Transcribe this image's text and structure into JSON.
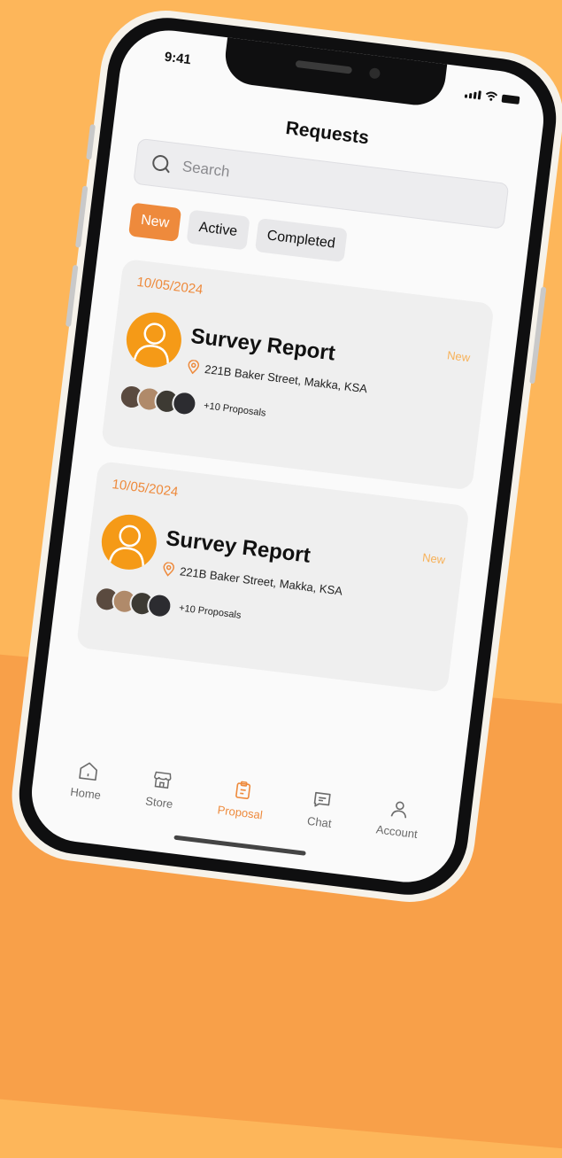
{
  "status_bar": {
    "time": "9:41"
  },
  "header": {
    "title": "Requests"
  },
  "search": {
    "placeholder": "Search",
    "icon": "search-icon"
  },
  "tabs": [
    {
      "label": "New",
      "active": true
    },
    {
      "label": "Active",
      "active": false
    },
    {
      "label": "Completed",
      "active": false
    }
  ],
  "requests": [
    {
      "date": "10/05/2024",
      "status": "New",
      "title": "Survey Report",
      "address": "221B Baker  Street, Makka, KSA",
      "proposals": "+10 Proposals"
    },
    {
      "date": "10/05/2024",
      "status": "New",
      "title": "Survey Report",
      "address": "221B Baker  Street, Makka, KSA",
      "proposals": "+10 Proposals"
    }
  ],
  "bottom_nav": [
    {
      "label": "Home",
      "icon": "home-icon",
      "active": false
    },
    {
      "label": "Store",
      "icon": "store-icon",
      "active": false
    },
    {
      "label": "Proposal",
      "icon": "clipboard-icon",
      "active": true
    },
    {
      "label": "Chat",
      "icon": "chat-icon",
      "active": false
    },
    {
      "label": "Account",
      "icon": "user-icon",
      "active": false
    }
  ],
  "colors": {
    "accent": "#EE8A3C",
    "avatar_bg": "#F59A17",
    "background": "#FDB65A",
    "background_lower": "#F8A049"
  }
}
